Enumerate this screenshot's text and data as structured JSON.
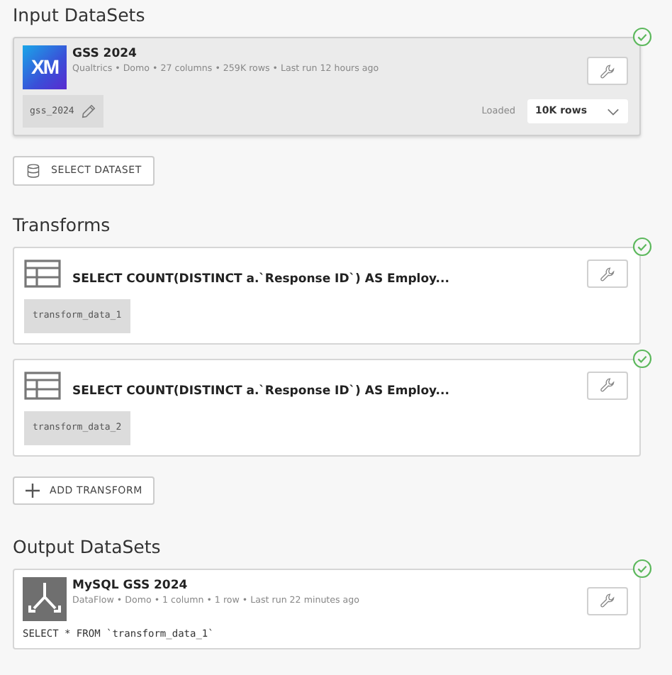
{
  "sections": [
    {
      "kind": "input",
      "heading": "Input DataSets",
      "cards": [
        {
          "logo": "XM",
          "title": "GSS 2024",
          "meta": "Qualtrics • Domo • 27 columns • 259K rows • Last run 12 hours ago",
          "tag": "gss_2024",
          "loaded_label": "Loaded",
          "rows_select": "10K rows",
          "validated": true
        }
      ],
      "add_button": "SELECT DATASET"
    },
    {
      "kind": "transform",
      "heading": "Transforms",
      "cards": [
        {
          "title": "SELECT COUNT(DISTINCT a.`Response ID`) AS Employ...",
          "tag": "transform_data_1",
          "validated": true
        },
        {
          "title": "SELECT COUNT(DISTINCT a.`Response ID`) AS Employ...",
          "tag": "transform_data_2",
          "validated": true
        }
      ],
      "add_button": "ADD TRANSFORM"
    },
    {
      "kind": "output",
      "heading": "Output DataSets",
      "cards": [
        {
          "title": "MySQL GSS 2024",
          "meta": "DataFlow • Domo • 1 column • 1 row • Last run 22 minutes ago",
          "sql": "SELECT * FROM `transform_data_1`",
          "validated": true
        }
      ]
    }
  ]
}
